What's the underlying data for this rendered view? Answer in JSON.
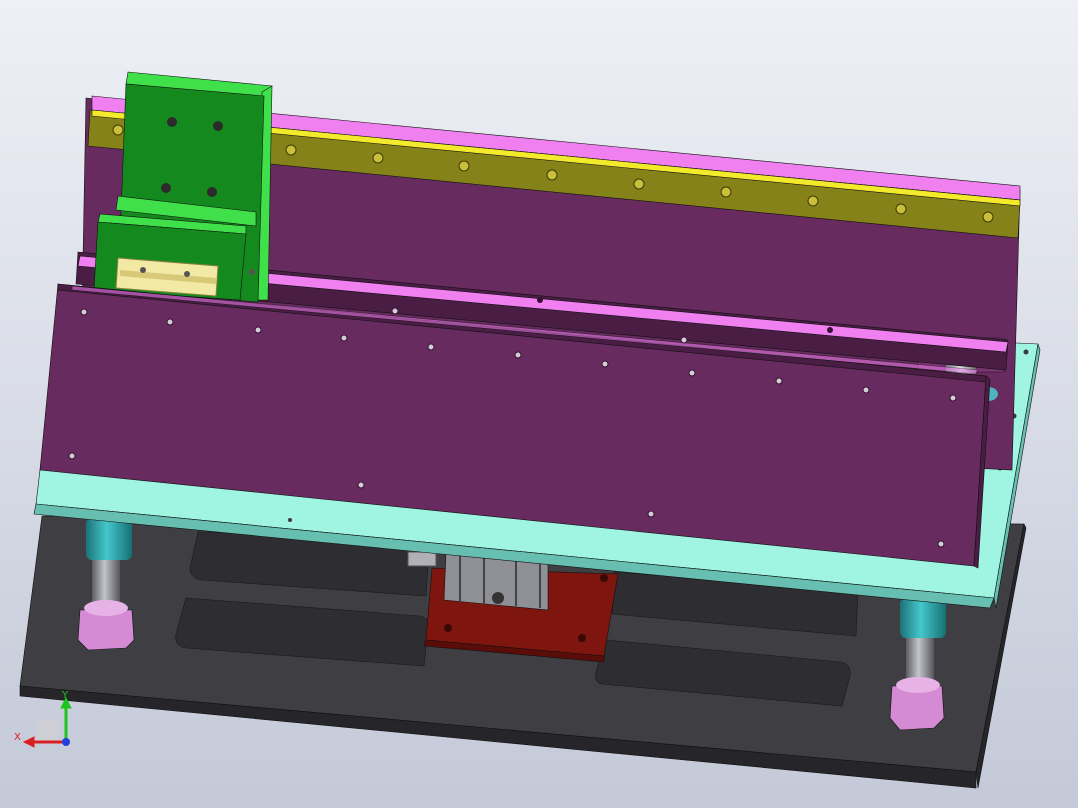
{
  "viewport": {
    "background_top": "#eef0f6",
    "background_bottom": "#c4c9d8"
  },
  "model": {
    "colors": {
      "base_plate": "#3f3f43",
      "base_edge": "#26262a",
      "pocket": "#2e2e32",
      "mint_plate": "#9ff5e2",
      "mint_edge": "#66bfb0",
      "purple_panel": "#672b5f",
      "purple_dark": "#4a1d45",
      "pink_rail": "#f07ff0",
      "olive_rail": "#86821a",
      "yellow_strip": "#f3ea2c",
      "green_block": "#148a1e",
      "green_bright": "#3fe04a",
      "red_block": "#7e150f",
      "teal_post": "#2aa1a7",
      "lilac_nut": "#d58bd4",
      "steel": "#8f8f96"
    }
  },
  "triad": {
    "x_label": "X",
    "y_label": "Y",
    "x_color": "#d92020",
    "y_color": "#1ec41e",
    "z_color": "#2040d8"
  }
}
